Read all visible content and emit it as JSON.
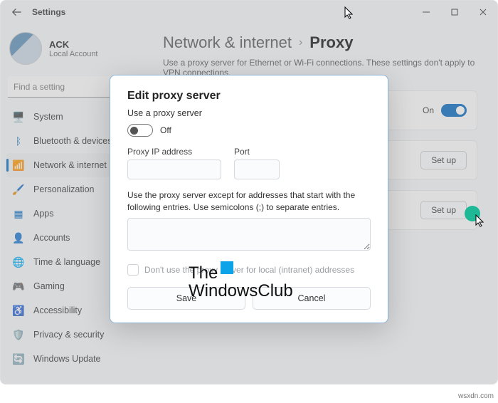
{
  "window": {
    "title": "Settings"
  },
  "user": {
    "name": "ACK",
    "account": "Local Account"
  },
  "search": {
    "placeholder": "Find a setting"
  },
  "sidebar": {
    "items": [
      {
        "icon": "🖥️",
        "label": "System"
      },
      {
        "icon": "ᛒ",
        "label": "Bluetooth & devices",
        "iconColor": "#0067c0"
      },
      {
        "icon": "📶",
        "label": "Network & internet",
        "iconColor": "#0067c0"
      },
      {
        "icon": "🖌️",
        "label": "Personalization"
      },
      {
        "icon": "▦",
        "label": "Apps",
        "iconColor": "#0067c0"
      },
      {
        "icon": "👤",
        "label": "Accounts"
      },
      {
        "icon": "🌐",
        "label": "Time & language"
      },
      {
        "icon": "🎮",
        "label": "Gaming"
      },
      {
        "icon": "♿",
        "label": "Accessibility",
        "iconColor": "#0067c0"
      },
      {
        "icon": "🛡️",
        "label": "Privacy & security"
      },
      {
        "icon": "🔄",
        "label": "Windows Update",
        "iconColor": "#0067c0"
      }
    ]
  },
  "breadcrumb": {
    "parent": "Network & internet",
    "current": "Proxy"
  },
  "description": "Use a proxy server for Ethernet or Wi-Fi connections. These settings don't apply to VPN connections.",
  "panel": {
    "onLabel": "On",
    "setup": "Set up"
  },
  "dialog": {
    "title": "Edit proxy server",
    "useLabel": "Use a proxy server",
    "toggleState": "Off",
    "ipLabel": "Proxy IP address",
    "portLabel": "Port",
    "exceptNote": "Use the proxy server except for addresses that start with the following entries. Use semicolons (;) to separate entries.",
    "localLabel": "Don't use the proxy server for local (intranet) addresses",
    "save": "Save",
    "cancel": "Cancel"
  },
  "watermark": {
    "line1": "The",
    "line2": "WindowsClub"
  },
  "footerUrl": "wsxdn.com"
}
